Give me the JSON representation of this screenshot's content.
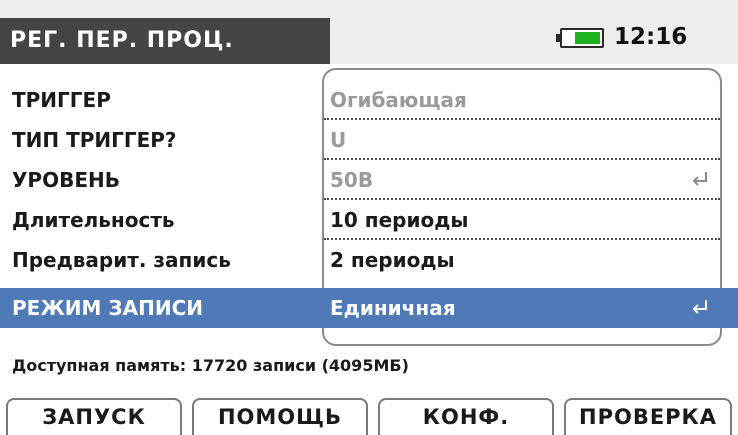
{
  "header": {
    "title": "РЕГ. ПЕР. ПРОЦ.",
    "battery_level": 0.7,
    "battery_color": "#1fb21f",
    "time": "12:16"
  },
  "settings": [
    {
      "label": "ТРИГГЕР",
      "value": "Огибающая"
    },
    {
      "label": "ТИП ТРИГГЕР?",
      "value": "U"
    },
    {
      "label": "УРОВЕНЬ",
      "value": "50В",
      "icon": "enter-icon"
    },
    {
      "label": "Длительность",
      "value": "10 периоды"
    },
    {
      "label": "Предварит. запись",
      "value": "2 периоды"
    },
    {
      "label": "РЕЖИМ ЗАПИСИ",
      "value": "Единичная",
      "icon": "enter-icon",
      "selected": true
    }
  ],
  "status": {
    "memory": "Доступная память: 17720 записи (4095МБ)"
  },
  "function_keys": {
    "f1": "ЗАПУСК",
    "f2": "ПОМОЩЬ",
    "f3": "КОНФ.",
    "f4": "ПРОВЕРКА"
  },
  "colors": {
    "selection": "#4f79b7",
    "title_bg": "#454545"
  }
}
